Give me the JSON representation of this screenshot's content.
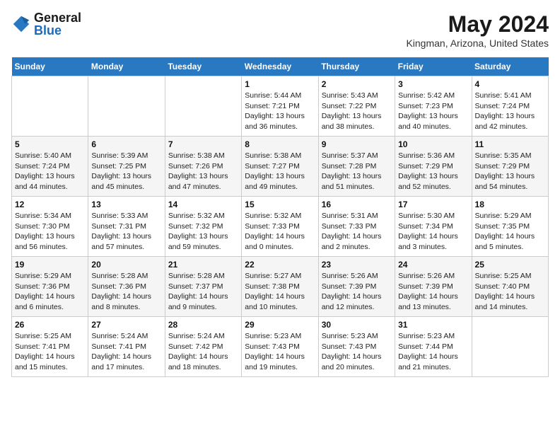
{
  "logo": {
    "general": "General",
    "blue": "Blue"
  },
  "title": "May 2024",
  "subtitle": "Kingman, Arizona, United States",
  "days_of_week": [
    "Sunday",
    "Monday",
    "Tuesday",
    "Wednesday",
    "Thursday",
    "Friday",
    "Saturday"
  ],
  "weeks": [
    [
      {
        "day": "",
        "info": ""
      },
      {
        "day": "",
        "info": ""
      },
      {
        "day": "",
        "info": ""
      },
      {
        "day": "1",
        "info": "Sunrise: 5:44 AM\nSunset: 7:21 PM\nDaylight: 13 hours and 36 minutes."
      },
      {
        "day": "2",
        "info": "Sunrise: 5:43 AM\nSunset: 7:22 PM\nDaylight: 13 hours and 38 minutes."
      },
      {
        "day": "3",
        "info": "Sunrise: 5:42 AM\nSunset: 7:23 PM\nDaylight: 13 hours and 40 minutes."
      },
      {
        "day": "4",
        "info": "Sunrise: 5:41 AM\nSunset: 7:24 PM\nDaylight: 13 hours and 42 minutes."
      }
    ],
    [
      {
        "day": "5",
        "info": "Sunrise: 5:40 AM\nSunset: 7:24 PM\nDaylight: 13 hours and 44 minutes."
      },
      {
        "day": "6",
        "info": "Sunrise: 5:39 AM\nSunset: 7:25 PM\nDaylight: 13 hours and 45 minutes."
      },
      {
        "day": "7",
        "info": "Sunrise: 5:38 AM\nSunset: 7:26 PM\nDaylight: 13 hours and 47 minutes."
      },
      {
        "day": "8",
        "info": "Sunrise: 5:38 AM\nSunset: 7:27 PM\nDaylight: 13 hours and 49 minutes."
      },
      {
        "day": "9",
        "info": "Sunrise: 5:37 AM\nSunset: 7:28 PM\nDaylight: 13 hours and 51 minutes."
      },
      {
        "day": "10",
        "info": "Sunrise: 5:36 AM\nSunset: 7:29 PM\nDaylight: 13 hours and 52 minutes."
      },
      {
        "day": "11",
        "info": "Sunrise: 5:35 AM\nSunset: 7:29 PM\nDaylight: 13 hours and 54 minutes."
      }
    ],
    [
      {
        "day": "12",
        "info": "Sunrise: 5:34 AM\nSunset: 7:30 PM\nDaylight: 13 hours and 56 minutes."
      },
      {
        "day": "13",
        "info": "Sunrise: 5:33 AM\nSunset: 7:31 PM\nDaylight: 13 hours and 57 minutes."
      },
      {
        "day": "14",
        "info": "Sunrise: 5:32 AM\nSunset: 7:32 PM\nDaylight: 13 hours and 59 minutes."
      },
      {
        "day": "15",
        "info": "Sunrise: 5:32 AM\nSunset: 7:33 PM\nDaylight: 14 hours and 0 minutes."
      },
      {
        "day": "16",
        "info": "Sunrise: 5:31 AM\nSunset: 7:33 PM\nDaylight: 14 hours and 2 minutes."
      },
      {
        "day": "17",
        "info": "Sunrise: 5:30 AM\nSunset: 7:34 PM\nDaylight: 14 hours and 3 minutes."
      },
      {
        "day": "18",
        "info": "Sunrise: 5:29 AM\nSunset: 7:35 PM\nDaylight: 14 hours and 5 minutes."
      }
    ],
    [
      {
        "day": "19",
        "info": "Sunrise: 5:29 AM\nSunset: 7:36 PM\nDaylight: 14 hours and 6 minutes."
      },
      {
        "day": "20",
        "info": "Sunrise: 5:28 AM\nSunset: 7:36 PM\nDaylight: 14 hours and 8 minutes."
      },
      {
        "day": "21",
        "info": "Sunrise: 5:28 AM\nSunset: 7:37 PM\nDaylight: 14 hours and 9 minutes."
      },
      {
        "day": "22",
        "info": "Sunrise: 5:27 AM\nSunset: 7:38 PM\nDaylight: 14 hours and 10 minutes."
      },
      {
        "day": "23",
        "info": "Sunrise: 5:26 AM\nSunset: 7:39 PM\nDaylight: 14 hours and 12 minutes."
      },
      {
        "day": "24",
        "info": "Sunrise: 5:26 AM\nSunset: 7:39 PM\nDaylight: 14 hours and 13 minutes."
      },
      {
        "day": "25",
        "info": "Sunrise: 5:25 AM\nSunset: 7:40 PM\nDaylight: 14 hours and 14 minutes."
      }
    ],
    [
      {
        "day": "26",
        "info": "Sunrise: 5:25 AM\nSunset: 7:41 PM\nDaylight: 14 hours and 15 minutes."
      },
      {
        "day": "27",
        "info": "Sunrise: 5:24 AM\nSunset: 7:41 PM\nDaylight: 14 hours and 17 minutes."
      },
      {
        "day": "28",
        "info": "Sunrise: 5:24 AM\nSunset: 7:42 PM\nDaylight: 14 hours and 18 minutes."
      },
      {
        "day": "29",
        "info": "Sunrise: 5:23 AM\nSunset: 7:43 PM\nDaylight: 14 hours and 19 minutes."
      },
      {
        "day": "30",
        "info": "Sunrise: 5:23 AM\nSunset: 7:43 PM\nDaylight: 14 hours and 20 minutes."
      },
      {
        "day": "31",
        "info": "Sunrise: 5:23 AM\nSunset: 7:44 PM\nDaylight: 14 hours and 21 minutes."
      },
      {
        "day": "",
        "info": ""
      }
    ]
  ]
}
